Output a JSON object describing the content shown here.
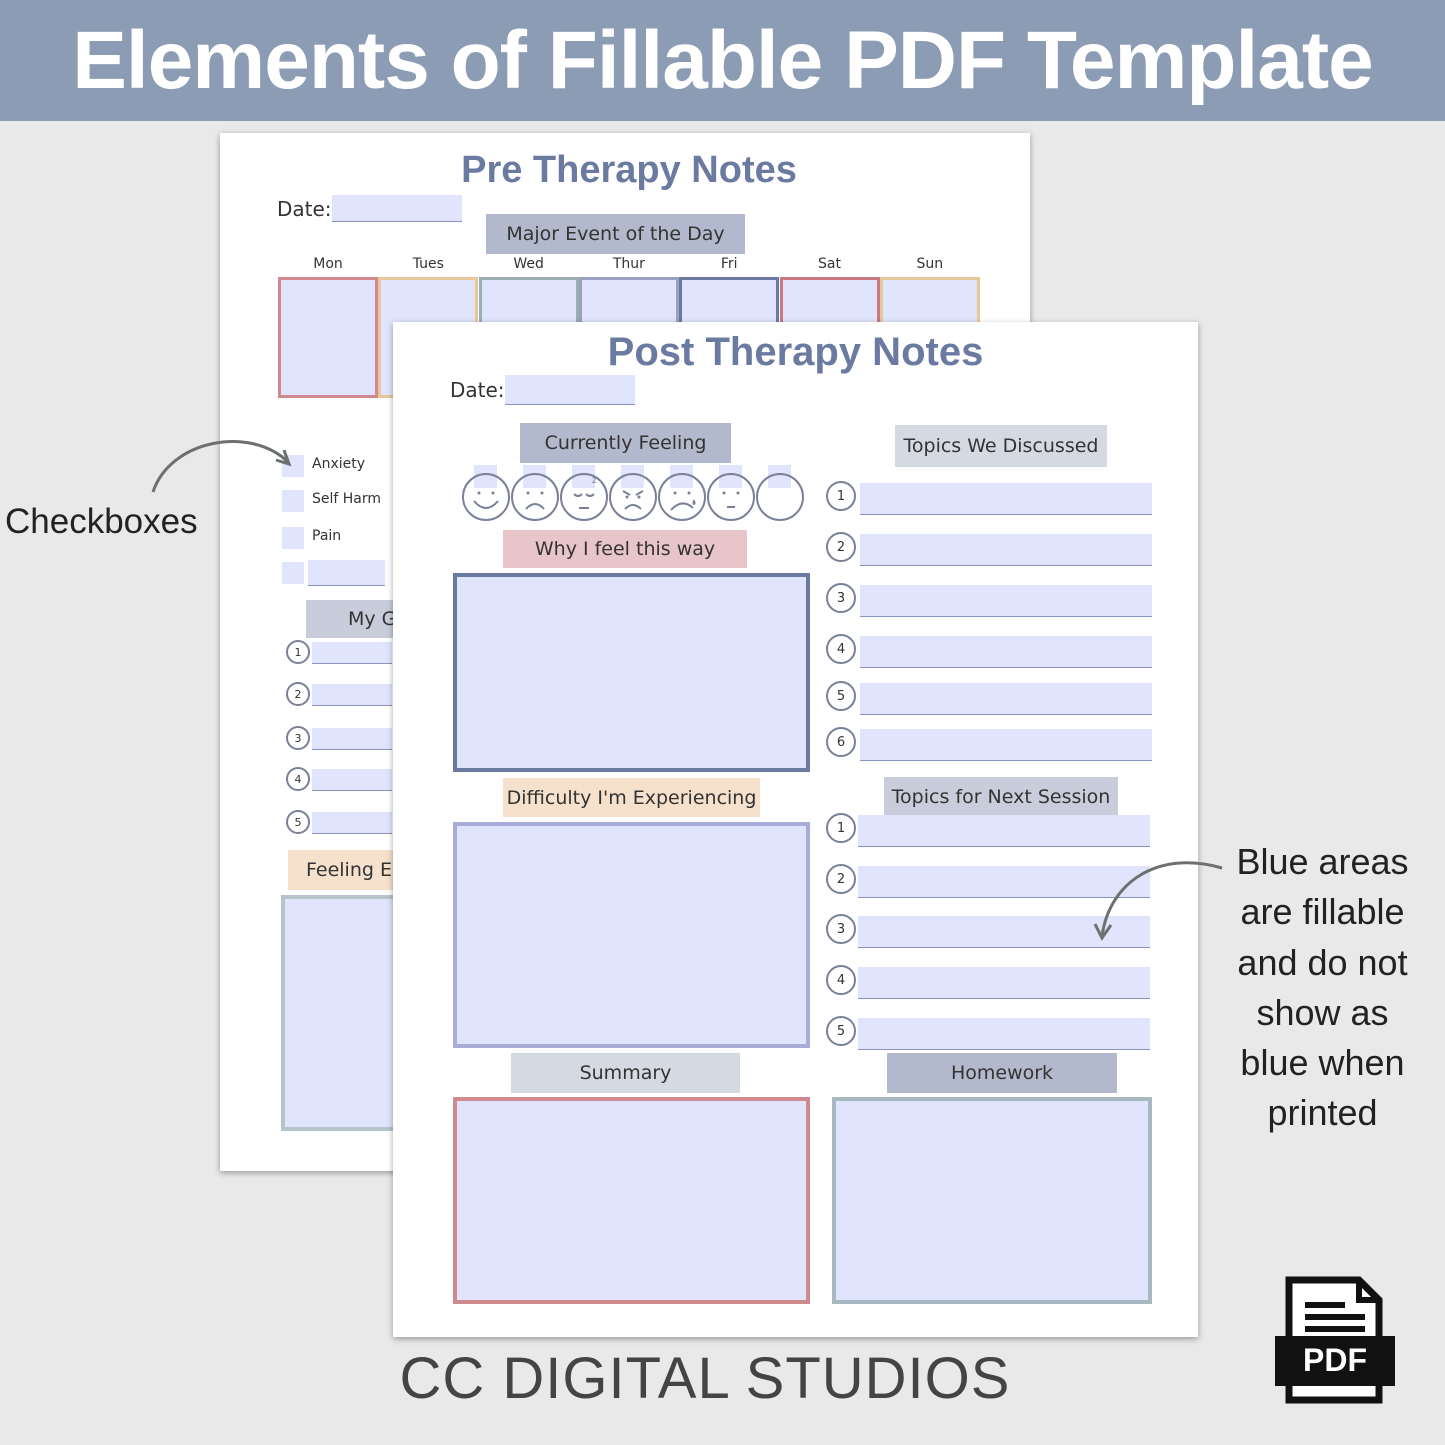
{
  "header": {
    "title": "Elements of Fillable PDF Template"
  },
  "colors": {
    "header_bg": "#8b9cb4",
    "title_color": "#6b7aa1",
    "fillable_blue": "#e0e4fc"
  },
  "pre_therapy": {
    "title": "Pre Therapy Notes",
    "date_label": "Date:",
    "major_event_label": "Major Event of the Day",
    "days": [
      "Mon",
      "Tues",
      "Wed",
      "Thur",
      "Fri",
      "Sat",
      "Sun"
    ],
    "checkboxes": [
      "Anxiety",
      "Self Harm",
      "Pain",
      ""
    ],
    "goals_label_partial": "My G",
    "numbers": [
      "1",
      "2",
      "3",
      "4",
      "5"
    ],
    "feeling_label_partial": "Feeling E"
  },
  "post_therapy": {
    "title": "Post Therapy Notes",
    "date_label": "Date:",
    "currently_feeling_label": "Currently Feeling",
    "emoji_faces": [
      "happy",
      "sad",
      "sleepy",
      "angry",
      "crying",
      "neutral",
      "blank"
    ],
    "why_label": "Why I feel this way",
    "difficulty_label": "Difficulty I'm Experiencing",
    "summary_label": "Summary",
    "topics_discussed_label": "Topics We Discussed",
    "topics_discussed_numbers": [
      "1",
      "2",
      "3",
      "4",
      "5",
      "6"
    ],
    "next_session_label": "Topics for Next Session",
    "next_session_numbers": [
      "1",
      "2",
      "3",
      "4",
      "5"
    ],
    "homework_label": "Homework"
  },
  "annotations": {
    "checkboxes": "Checkboxes",
    "blue_areas": [
      "Blue areas",
      "are fillable",
      "and do not",
      "show as",
      "blue when",
      "printed"
    ]
  },
  "footer": {
    "brand": "CC DIGITAL STUDIOS"
  },
  "pdf_icon": {
    "label": "PDF"
  }
}
